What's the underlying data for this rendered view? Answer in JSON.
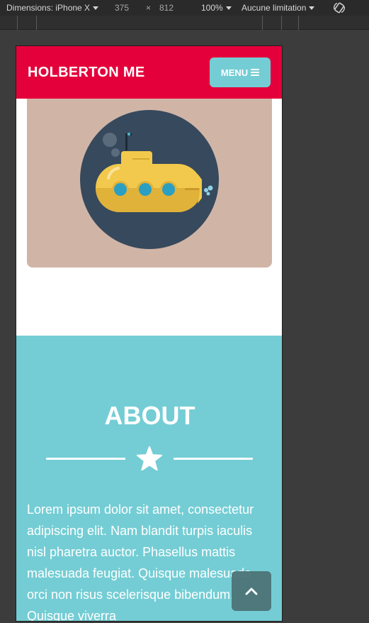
{
  "devtools": {
    "dimensions_label": "Dimensions: iPhone X",
    "width": "375",
    "times": "×",
    "height": "812",
    "zoom": "100%",
    "throttle": "Aucune limitation",
    "rotate_icon": "rotate-icon"
  },
  "site": {
    "brand": "HOLBERTON ME",
    "menu_label": "MENU",
    "menu_icon": "hamburger-icon",
    "hero_image": "submarine-illustration",
    "about": {
      "title": "ABOUT",
      "divider_icon": "star-icon",
      "paragraph": "Lorem ipsum dolor sit amet, consectetur adipiscing elit. Nam blandit turpis iaculis nisl pharetra auctor. Phasellus mattis malesuada feugiat. Quisque malesuada orci non risus scelerisque bibendum. Quisque viverra"
    },
    "scroll_top_icon": "chevron-up-icon"
  },
  "colors": {
    "header": "#e4003a",
    "accent": "#74cdd4",
    "hero_bg": "#d0b5a7",
    "scroll_button": "#4d7478"
  }
}
